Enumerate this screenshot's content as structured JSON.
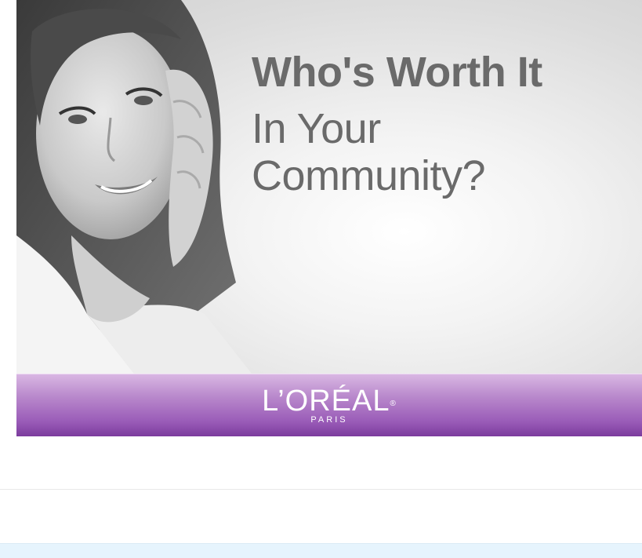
{
  "ad": {
    "headline": "Who's Worth It",
    "subline_1": "In Your",
    "subline_2": "Community?",
    "brand": "L’ORÉAL",
    "brand_mark": "®",
    "brand_sub": "PARIS"
  },
  "colors": {
    "footer_purple": "#9a5cb8",
    "headline_gray": "#6a6a6a",
    "bottom_panel": "#e6f4fd"
  }
}
